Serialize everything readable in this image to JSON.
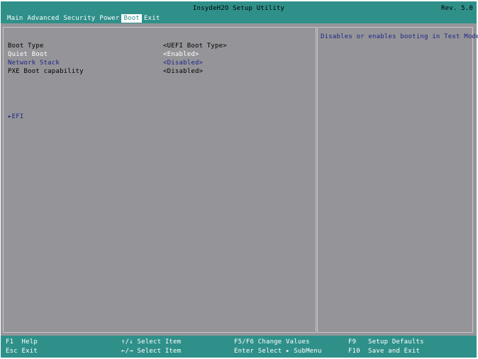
{
  "title": "InsydeH2O Setup Utility",
  "revision": "Rev. 5.0",
  "menu": [
    {
      "label": "Main"
    },
    {
      "label": "Advanced"
    },
    {
      "label": "Security"
    },
    {
      "label": "Power"
    },
    {
      "label": "Boot",
      "active": true
    },
    {
      "label": "Exit"
    }
  ],
  "settings": [
    {
      "label": "Boot Type",
      "value": "<UEFI Boot Type>",
      "color": "#000000"
    },
    {
      "label": "Quiet Boot",
      "value": "<Enabled>",
      "color": "#ffffff",
      "selected": true
    },
    {
      "label": "Network Stack",
      "value": "<Disabled>",
      "color": "#1d2585"
    },
    {
      "label": "PXE Boot capability",
      "value": "<Disabled>",
      "color": "#000000"
    }
  ],
  "efi_item": "▸EFI",
  "help_text": "Disables or enables booting in Text Mode.",
  "footer": {
    "row1": [
      {
        "key": "F1",
        "desc": "Help"
      },
      {
        "key": "↑/↓",
        "desc": "Select Item"
      },
      {
        "key": "F5/F6",
        "desc": "Change Values"
      },
      {
        "key": "F9",
        "desc": "Setup Defaults"
      }
    ],
    "row2": [
      {
        "key": "Esc",
        "desc": "Exit"
      },
      {
        "key": "←/→",
        "desc": "Select Item"
      },
      {
        "key": "Enter",
        "desc": "Select ▸ SubMenu"
      },
      {
        "key": "F10",
        "desc": "Save and Exit"
      }
    ]
  },
  "colors": {
    "accent": "#2f908a",
    "background": "#959599",
    "highlight": "#ffffff",
    "link": "#1d2585"
  }
}
